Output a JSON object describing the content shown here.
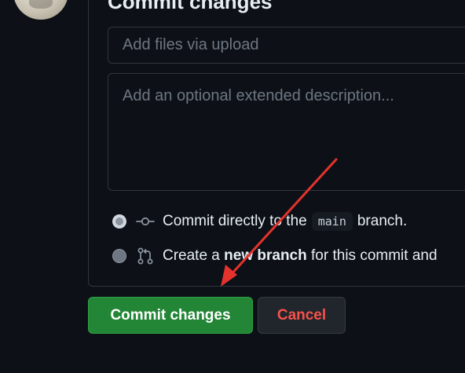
{
  "commit": {
    "title": "Commit changes",
    "summary_placeholder": "Add files via upload",
    "description_placeholder": "Add an optional extended description..."
  },
  "options": {
    "direct": {
      "prefix": "Commit directly to the",
      "branch": "main",
      "suffix": "branch.",
      "selected": true
    },
    "new_branch": {
      "prefix": "Create a",
      "bold": "new branch",
      "suffix": "for this commit and",
      "selected": false
    }
  },
  "buttons": {
    "commit_label": "Commit changes",
    "cancel_label": "Cancel"
  },
  "colors": {
    "background": "#0d1117",
    "border": "#30363d",
    "commit_button": "#238636",
    "cancel_text": "#f85149",
    "annotation_arrow": "#e5322d"
  },
  "icons": {
    "commit_icon": "git-commit-icon",
    "branch_icon": "git-pull-request-icon",
    "arrow": "annotation-arrow"
  }
}
